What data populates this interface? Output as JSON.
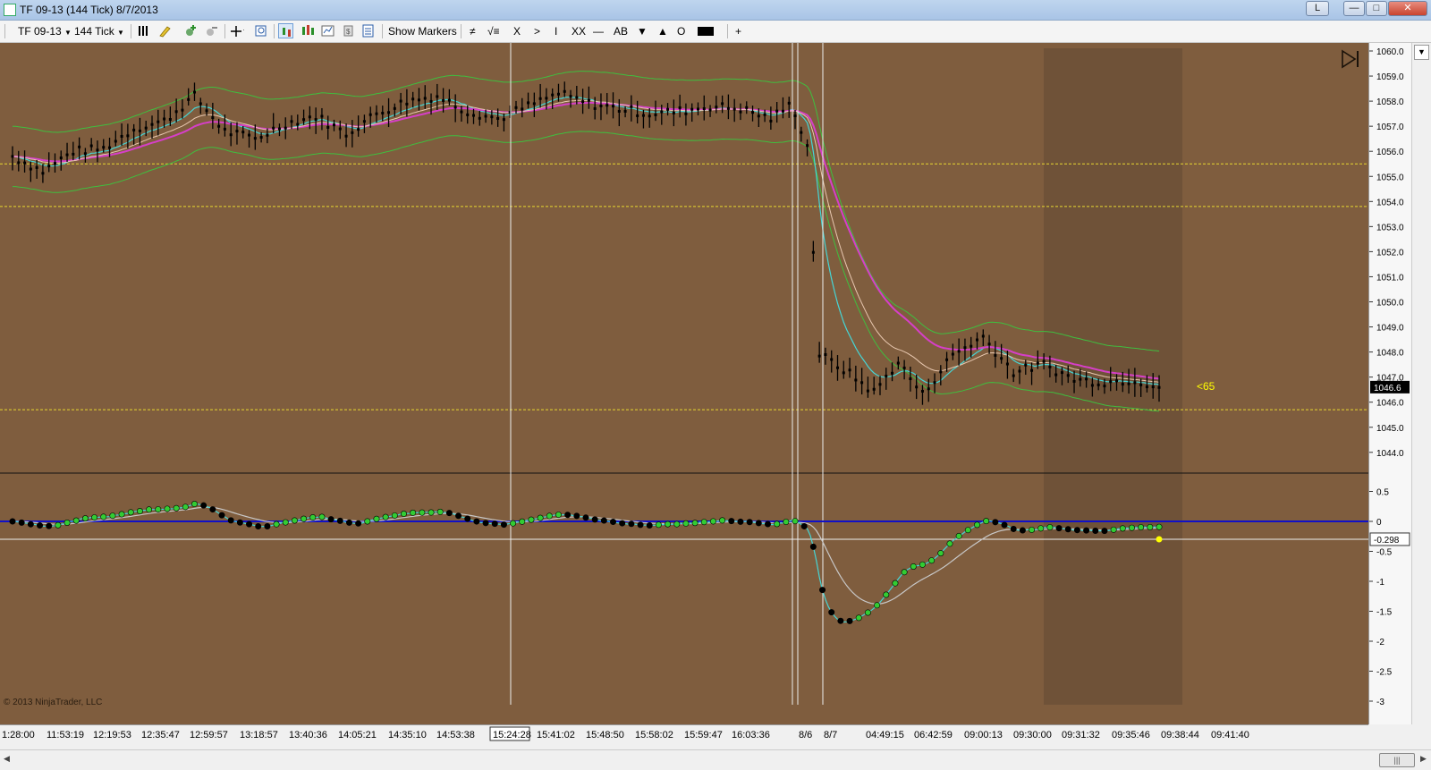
{
  "window": {
    "title": "TF 09-13 (144 Tick)  8/7/2013",
    "link_button": "L",
    "minimize_icon": "minimize-icon",
    "maximize_icon": "maximize-icon",
    "close_icon": "close-icon"
  },
  "toolbar": {
    "instrument": "TF 09-13",
    "interval": "144 Tick",
    "show_markers": "Show Markers",
    "draw_tools": [
      "≠",
      "√≡",
      "X",
      ">",
      "I",
      "XX",
      "—",
      "AB",
      "▼",
      "▲",
      "O"
    ],
    "plus": "+"
  },
  "colors": {
    "background": "#7f5d3e",
    "shaded_region": "#6f5238",
    "green_band": "#3fbf3f",
    "cyan_ma": "#45d6d6",
    "magenta_ma": "#d63fc8",
    "pink_ma": "#e8c8b0",
    "yellow_level": "#e8d830",
    "zero_line": "#1010c8",
    "up_dot": "#33cc33",
    "down_dot": "#000000"
  },
  "chart_data": [
    {
      "type": "candlestick",
      "panel": "price",
      "ylim": [
        1043.8,
        1060.2
      ],
      "y_ticks": [
        "1060.0",
        "1059.0",
        "1058.0",
        "1057.0",
        "1056.0",
        "1055.0",
        "1054.0",
        "1053.0",
        "1052.0",
        "1051.0",
        "1050.0",
        "1049.0",
        "1048.0",
        "1047.0",
        "1046.0",
        "1045.0",
        "1044.0"
      ],
      "y_tick_values": [
        1060,
        1059,
        1058,
        1057,
        1056,
        1055,
        1054,
        1053,
        1052,
        1051,
        1050,
        1049,
        1048,
        1047,
        1046,
        1045,
        1044
      ],
      "last_price_label": "1046.6",
      "last_price": 1046.6,
      "annotation": "<65",
      "levels": [
        1055.5,
        1053.8,
        1045.7
      ],
      "closes": [
        {
          "bar": 0,
          "price": 1055.8
        },
        {
          "bar": 10,
          "price": 1055.2
        },
        {
          "bar": 20,
          "price": 1056.0
        },
        {
          "bar": 30,
          "price": 1056.1
        },
        {
          "bar": 40,
          "price": 1056.9
        },
        {
          "bar": 50,
          "price": 1057.2
        },
        {
          "bar": 60,
          "price": 1058.2
        },
        {
          "bar": 70,
          "price": 1056.8
        },
        {
          "bar": 80,
          "price": 1056.5
        },
        {
          "bar": 90,
          "price": 1057.1
        },
        {
          "bar": 100,
          "price": 1057.4
        },
        {
          "bar": 110,
          "price": 1056.7
        },
        {
          "bar": 120,
          "price": 1057.5
        },
        {
          "bar": 130,
          "price": 1058.0
        },
        {
          "bar": 140,
          "price": 1058.2
        },
        {
          "bar": 150,
          "price": 1057.6
        },
        {
          "bar": 160,
          "price": 1057.3
        },
        {
          "bar": 170,
          "price": 1057.8
        },
        {
          "bar": 180,
          "price": 1058.3
        },
        {
          "bar": 190,
          "price": 1057.9
        },
        {
          "bar": 200,
          "price": 1057.7
        },
        {
          "bar": 210,
          "price": 1057.5
        },
        {
          "bar": 220,
          "price": 1057.6
        },
        {
          "bar": 230,
          "price": 1057.8
        },
        {
          "bar": 240,
          "price": 1057.7
        },
        {
          "bar": 250,
          "price": 1057.3
        },
        {
          "bar": 257,
          "price": 1057.9
        },
        {
          "bar": 262,
          "price": 1056.2
        },
        {
          "bar": 266,
          "price": 1047.9
        },
        {
          "bar": 274,
          "price": 1047.3
        },
        {
          "bar": 284,
          "price": 1046.4
        },
        {
          "bar": 292,
          "price": 1047.6
        },
        {
          "bar": 300,
          "price": 1046.3
        },
        {
          "bar": 310,
          "price": 1047.9
        },
        {
          "bar": 320,
          "price": 1048.6
        },
        {
          "bar": 330,
          "price": 1047.2
        },
        {
          "bar": 340,
          "price": 1047.5
        },
        {
          "bar": 350,
          "price": 1046.9
        },
        {
          "bar": 360,
          "price": 1046.8
        },
        {
          "bar": 370,
          "price": 1046.9
        },
        {
          "bar": 378,
          "price": 1046.6
        }
      ]
    },
    {
      "type": "line",
      "panel": "oscillator",
      "ylim": [
        -3.05,
        0.65
      ],
      "y_ticks": [
        "0.5",
        "0",
        "-0.5",
        "-1",
        "-1.5",
        "-2",
        "-2.5",
        "-3"
      ],
      "y_tick_values": [
        0.5,
        0,
        -0.5,
        -1,
        -1.5,
        -2,
        -2.5,
        -3
      ],
      "last_value_label": "-0.298",
      "last_value": -0.298
    }
  ],
  "x_axis": {
    "labels": [
      "1:28:00",
      "11:53:19",
      "12:19:53",
      "12:35:47",
      "12:59:57",
      "13:18:57",
      "13:40:36",
      "14:05:21",
      "14:35:10",
      "14:53:38",
      "15:41:02",
      "15:48:50",
      "15:58:02",
      "15:59:47",
      "16:03:36",
      "8/6",
      "8/7",
      "04:49:15",
      "06:42:59",
      "09:00:13",
      "09:30:00",
      "09:31:32",
      "09:35:46",
      "09:38:44",
      "09:41:40"
    ],
    "cursor_label": "15:24:28"
  },
  "copyright": "© 2013 NinjaTrader, LLC"
}
